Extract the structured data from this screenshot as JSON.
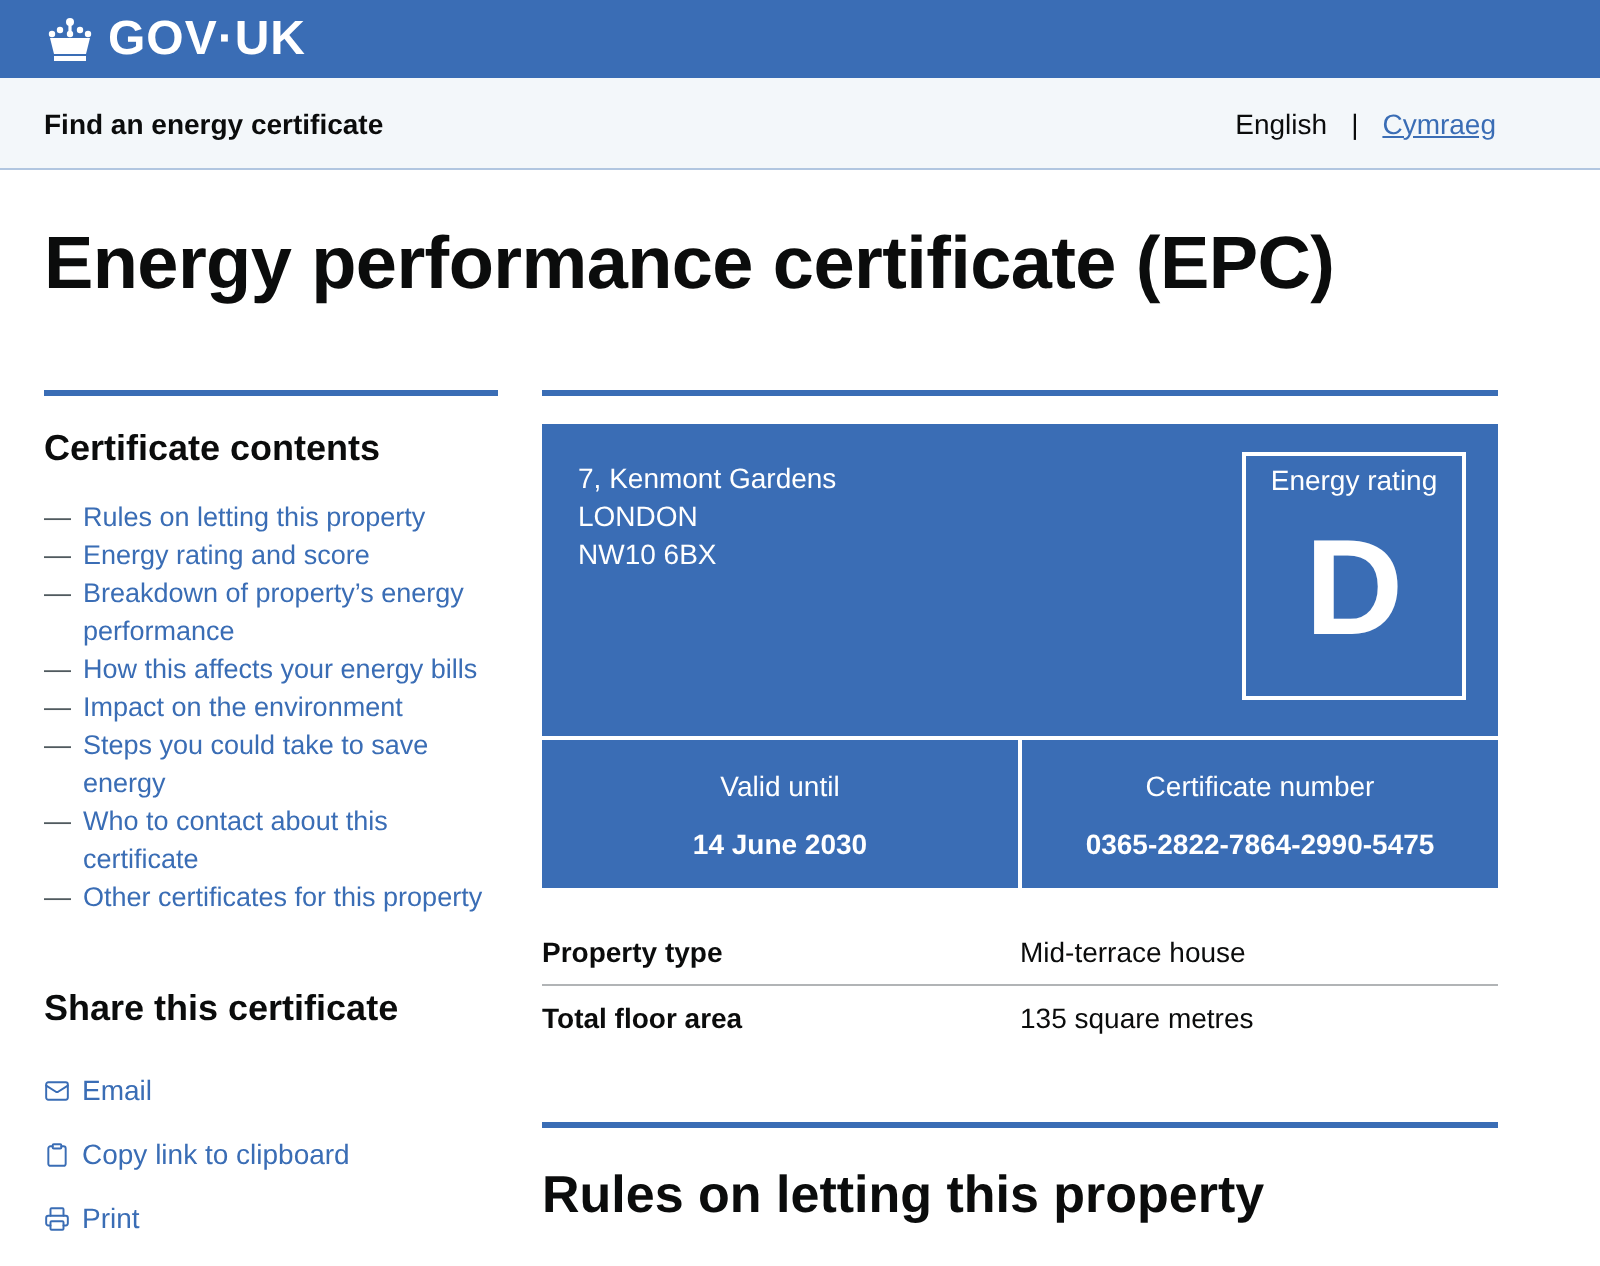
{
  "header": {
    "logo": "GOV·UK"
  },
  "service_bar": {
    "name": "Find an energy certificate",
    "separator": "|",
    "languages": [
      {
        "label": "English",
        "selected": true
      },
      {
        "label": "Cymraeg",
        "selected": false
      }
    ]
  },
  "title": "Energy performance certificate (EPC)",
  "contents": {
    "heading": "Certificate contents",
    "marker": "—",
    "items": [
      "Rules on letting this property",
      "Energy rating and score",
      "Breakdown of property’s energy performance",
      "How this affects your energy bills",
      "Impact on the environment",
      "Steps you could take to save energy",
      "Who to contact about this certificate",
      "Other certificates for this property"
    ]
  },
  "share": {
    "heading": "Share this certificate",
    "items": [
      {
        "kind": "email",
        "label": "Email"
      },
      {
        "kind": "copy",
        "label": "Copy link to clipboard"
      },
      {
        "kind": "print",
        "label": "Print"
      }
    ]
  },
  "certificate": {
    "address": [
      "7, Kenmont Gardens",
      "LONDON",
      "NW10 6BX"
    ],
    "rating_label": "Energy rating",
    "rating": "D",
    "valid_label": "Valid until",
    "valid_until": "14 June 2030",
    "number_label": "Certificate number",
    "number": "0365-2822-7864-2990-5475"
  },
  "summary": [
    {
      "label": "Property type",
      "value": "Mid-terrace house"
    },
    {
      "label": "Total floor area",
      "value": "135 square metres"
    }
  ],
  "section_heading": "Rules on letting this property"
}
